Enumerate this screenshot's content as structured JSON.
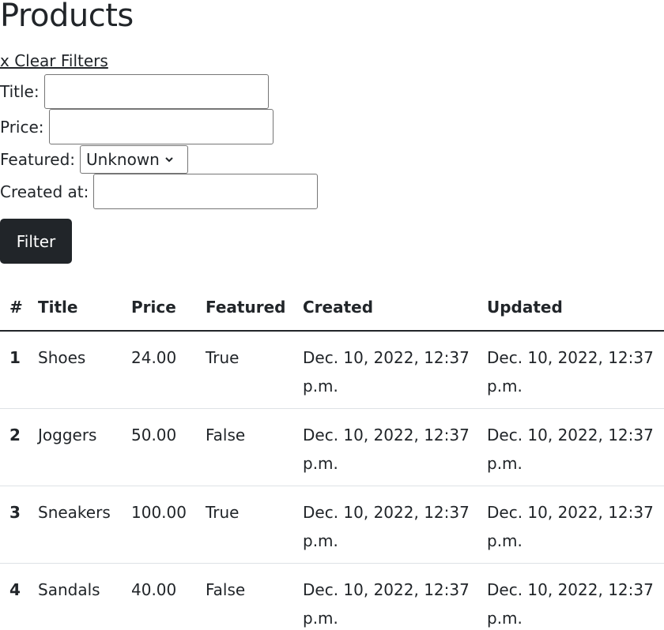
{
  "page": {
    "title": "Products",
    "clear_filters": "x Clear Filters"
  },
  "filters": {
    "title_label": "Title:",
    "title_value": "",
    "price_label": "Price:",
    "price_value": "",
    "featured_label": "Featured:",
    "featured_selected": "Unknown",
    "created_label": "Created at:",
    "created_value": "",
    "submit_label": "Filter"
  },
  "table": {
    "headers": [
      "#",
      "Title",
      "Price",
      "Featured",
      "Created",
      "Updated"
    ],
    "rows": [
      {
        "num": "1",
        "title": "Shoes",
        "price": "24.00",
        "featured": "True",
        "created": "Dec. 10, 2022, 12:37 p.m.",
        "updated": "Dec. 10, 2022, 12:37 p.m."
      },
      {
        "num": "2",
        "title": "Joggers",
        "price": "50.00",
        "featured": "False",
        "created": "Dec. 10, 2022, 12:37 p.m.",
        "updated": "Dec. 10, 2022, 12:37 p.m."
      },
      {
        "num": "3",
        "title": "Sneakers",
        "price": "100.00",
        "featured": "True",
        "created": "Dec. 10, 2022, 12:37 p.m.",
        "updated": "Dec. 10, 2022, 12:37 p.m."
      },
      {
        "num": "4",
        "title": "Sandals",
        "price": "40.00",
        "featured": "False",
        "created": "Dec. 10, 2022, 12:37 p.m.",
        "updated": "Dec. 10, 2022, 12:37 p.m."
      }
    ]
  }
}
